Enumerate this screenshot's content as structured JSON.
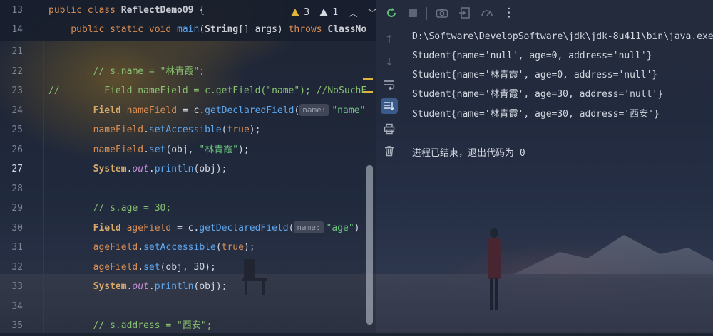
{
  "editor": {
    "warnings_count": "3",
    "errors_count": "1",
    "sticky": [
      {
        "num": "13",
        "parts": [
          {
            "t": "public ",
            "c": "kw"
          },
          {
            "t": "class ",
            "c": "kw"
          },
          {
            "t": "ReflectDemo09 ",
            "c": "cls"
          },
          {
            "t": "{",
            "c": "pl"
          }
        ]
      },
      {
        "num": "14",
        "parts": [
          {
            "t": "    public ",
            "c": "kw"
          },
          {
            "t": "static ",
            "c": "kw"
          },
          {
            "t": "void ",
            "c": "kw"
          },
          {
            "t": "main",
            "c": "fn"
          },
          {
            "t": "(",
            "c": "pl"
          },
          {
            "t": "String",
            "c": "cls"
          },
          {
            "t": "[] args) ",
            "c": "pl"
          },
          {
            "t": "throws ",
            "c": "kw"
          },
          {
            "t": "ClassNo",
            "c": "cls"
          }
        ]
      }
    ],
    "lines": [
      {
        "num": "21",
        "cur": false,
        "parts": []
      },
      {
        "num": "22",
        "cur": false,
        "parts": [
          {
            "t": "        // s.name = \"林青霞\";",
            "c": "cmt"
          }
        ]
      },
      {
        "num": "23",
        "cur": false,
        "parts": [
          {
            "t": "//        Field nameField = c.getField(\"name\"); //NoSuchF",
            "c": "cmt"
          }
        ]
      },
      {
        "num": "24",
        "cur": false,
        "parts": [
          {
            "t": "        Field ",
            "c": "bold"
          },
          {
            "t": "nameField",
            "c": "field"
          },
          {
            "t": " = c.",
            "c": "pl"
          },
          {
            "t": "getDeclaredField",
            "c": "fn"
          },
          {
            "t": "(",
            "c": "pl"
          },
          {
            "hint": "name:"
          },
          {
            "t": "\"name\"",
            "c": "str"
          }
        ]
      },
      {
        "num": "25",
        "cur": false,
        "parts": [
          {
            "t": "        nameField",
            "c": "field"
          },
          {
            "t": ".",
            "c": "pl"
          },
          {
            "t": "setAccessible",
            "c": "fn"
          },
          {
            "t": "(",
            "c": "pl"
          },
          {
            "t": "true",
            "c": "kw"
          },
          {
            "t": ");",
            "c": "pl"
          }
        ]
      },
      {
        "num": "26",
        "cur": false,
        "parts": [
          {
            "t": "        nameField",
            "c": "field"
          },
          {
            "t": ".",
            "c": "pl"
          },
          {
            "t": "set",
            "c": "fn"
          },
          {
            "t": "(obj, ",
            "c": "pl"
          },
          {
            "t": "\"林青霞\"",
            "c": "str"
          },
          {
            "t": ");",
            "c": "pl"
          }
        ]
      },
      {
        "num": "27",
        "cur": true,
        "parts": [
          {
            "t": "        System",
            "c": "bold"
          },
          {
            "t": ".",
            "c": "pl"
          },
          {
            "t": "out",
            "c": "out"
          },
          {
            "t": ".",
            "c": "pl"
          },
          {
            "t": "println",
            "c": "fn"
          },
          {
            "t": "(obj);",
            "c": "pl"
          }
        ]
      },
      {
        "num": "28",
        "cur": false,
        "parts": []
      },
      {
        "num": "29",
        "cur": false,
        "parts": [
          {
            "t": "        // s.age = 30;",
            "c": "cmt"
          }
        ]
      },
      {
        "num": "30",
        "cur": false,
        "parts": [
          {
            "t": "        Field ",
            "c": "bold"
          },
          {
            "t": "ageField",
            "c": "field"
          },
          {
            "t": " = c.",
            "c": "pl"
          },
          {
            "t": "getDeclaredField",
            "c": "fn"
          },
          {
            "t": "(",
            "c": "pl"
          },
          {
            "hint": "name:"
          },
          {
            "t": "\"age\"",
            "c": "str"
          },
          {
            "t": ")",
            "c": "pl"
          }
        ]
      },
      {
        "num": "31",
        "cur": false,
        "parts": [
          {
            "t": "        ageField",
            "c": "field"
          },
          {
            "t": ".",
            "c": "pl"
          },
          {
            "t": "setAccessible",
            "c": "fn"
          },
          {
            "t": "(",
            "c": "pl"
          },
          {
            "t": "true",
            "c": "kw"
          },
          {
            "t": ");",
            "c": "pl"
          }
        ]
      },
      {
        "num": "32",
        "cur": false,
        "parts": [
          {
            "t": "        ageField",
            "c": "field"
          },
          {
            "t": ".",
            "c": "pl"
          },
          {
            "t": "set",
            "c": "fn"
          },
          {
            "t": "(obj, ",
            "c": "pl"
          },
          {
            "t": "30",
            "c": "pl"
          },
          {
            "t": ");",
            "c": "pl"
          }
        ]
      },
      {
        "num": "33",
        "cur": false,
        "parts": [
          {
            "t": "        System",
            "c": "bold"
          },
          {
            "t": ".",
            "c": "pl"
          },
          {
            "t": "out",
            "c": "out"
          },
          {
            "t": ".",
            "c": "pl"
          },
          {
            "t": "println",
            "c": "fn"
          },
          {
            "t": "(obj);",
            "c": "pl"
          }
        ]
      },
      {
        "num": "34",
        "cur": false,
        "parts": []
      },
      {
        "num": "35",
        "cur": false,
        "parts": [
          {
            "t": "        // s.address = \"西安\";",
            "c": "cmt"
          }
        ]
      }
    ]
  },
  "run": {
    "toolbar_icons": [
      "rerun-icon",
      "stop-icon",
      "camera-icon",
      "exit-icon",
      "profiler-icon",
      "more-icon"
    ],
    "more_glyph": "⋮",
    "console_lines": [
      "D:\\Software\\DevelopSoftware\\jdk\\jdk-8u411\\bin\\java.exe",
      "Student{name='null', age=0, address='null'}",
      "Student{name='林青霞', age=0, address='null'}",
      "Student{name='林青霞', age=30, address='null'}",
      "Student{name='林青霞', age=30, address='西安'}",
      "",
      "进程已结束，退出代码为 0"
    ]
  }
}
